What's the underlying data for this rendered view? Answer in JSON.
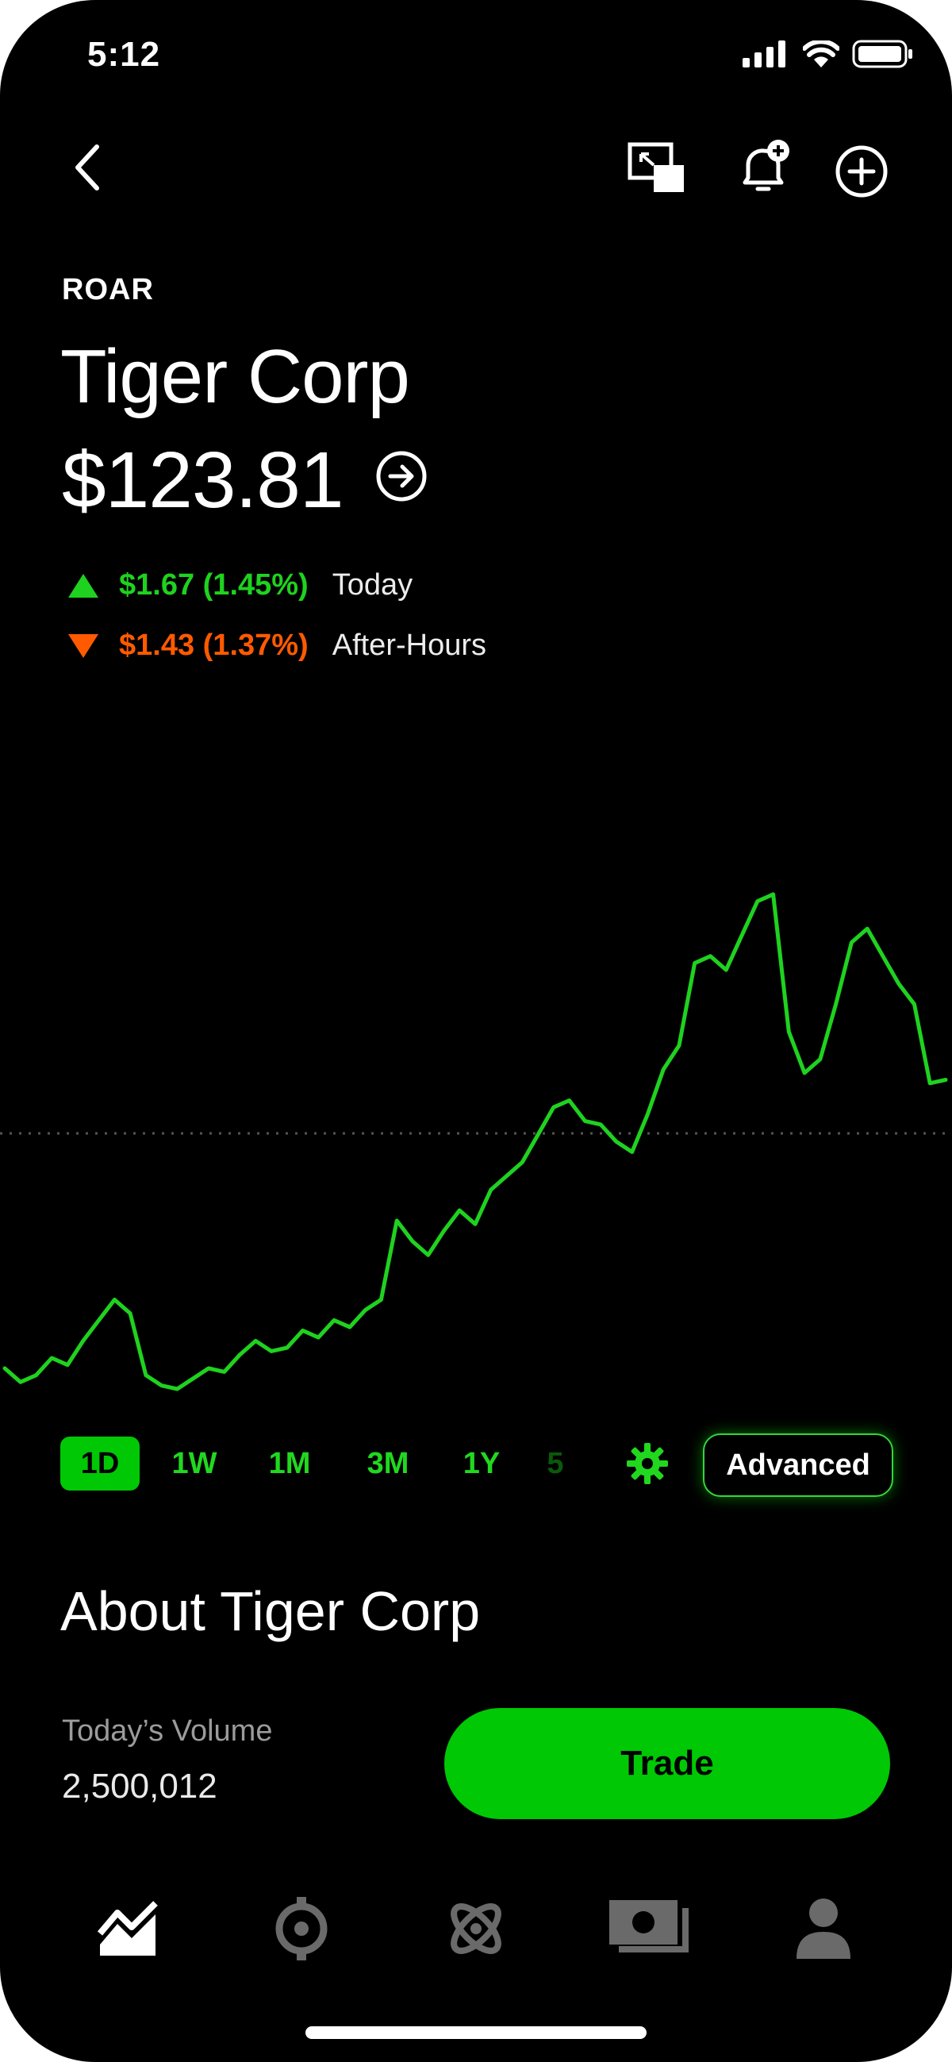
{
  "status_bar": {
    "time": "5:12",
    "icons": [
      "signal-icon",
      "wifi-icon",
      "battery-icon"
    ]
  },
  "header": {
    "icons": [
      "back-chevron-icon",
      "picture-in-picture-icon",
      "bell-plus-icon",
      "add-circle-icon"
    ]
  },
  "stock": {
    "ticker": "ROAR",
    "name": "Tiger Corp",
    "price": "$123.81",
    "today_change": "$1.67 (1.45%)",
    "today_label": "Today",
    "after_hours_change": "$1.43 (1.37%)",
    "after_hours_label": "After-Hours"
  },
  "colors": {
    "up": "#1fd21f",
    "down": "#ff5a00",
    "accent": "#00c805",
    "background": "#000000"
  },
  "chart_data": {
    "type": "line",
    "title": "",
    "xlabel": "",
    "ylabel": "",
    "baseline_reference": "previous close (dotted line)",
    "x": [
      0,
      1,
      2,
      3,
      4,
      5,
      6,
      7,
      8,
      9,
      10,
      11,
      12,
      13,
      14,
      15,
      16,
      17,
      18,
      19,
      20,
      21,
      22,
      23,
      24,
      25,
      26,
      27,
      28,
      29,
      30,
      31,
      32,
      33,
      34,
      35,
      36,
      37,
      38,
      39,
      40,
      41,
      42,
      43,
      44,
      45,
      46,
      47,
      48,
      49,
      50,
      51,
      52,
      53,
      54,
      55,
      56,
      57,
      58,
      59,
      60
    ],
    "series": [
      {
        "values": [
          52,
          48,
          50,
          55,
          53,
          60,
          66,
          72,
          68,
          50,
          47,
          46,
          49,
          52,
          51,
          56,
          60,
          57,
          58,
          63,
          61,
          66,
          64,
          69,
          72,
          95,
          89,
          85,
          92,
          98,
          94,
          104,
          108,
          112,
          120,
          128,
          130,
          124,
          123,
          118,
          115,
          126,
          139,
          146,
          170,
          172,
          168,
          178,
          188,
          190,
          150,
          138,
          142,
          158,
          176,
          180,
          172,
          164,
          158,
          135,
          136
        ]
      }
    ]
  },
  "ranges": {
    "items": [
      "1D",
      "1W",
      "1M",
      "3M",
      "1Y",
      "5"
    ],
    "active": "1D",
    "settings_icon": "gear-icon",
    "advanced_label": "Advanced"
  },
  "about": {
    "title": "About Tiger Corp"
  },
  "volume": {
    "label": "Today’s Volume",
    "value": "2,500,012"
  },
  "trade": {
    "label": "Trade"
  },
  "tabbar": {
    "icons": [
      "investing-icon",
      "crypto-icon",
      "browse-icon",
      "cash-icon",
      "account-icon"
    ]
  }
}
